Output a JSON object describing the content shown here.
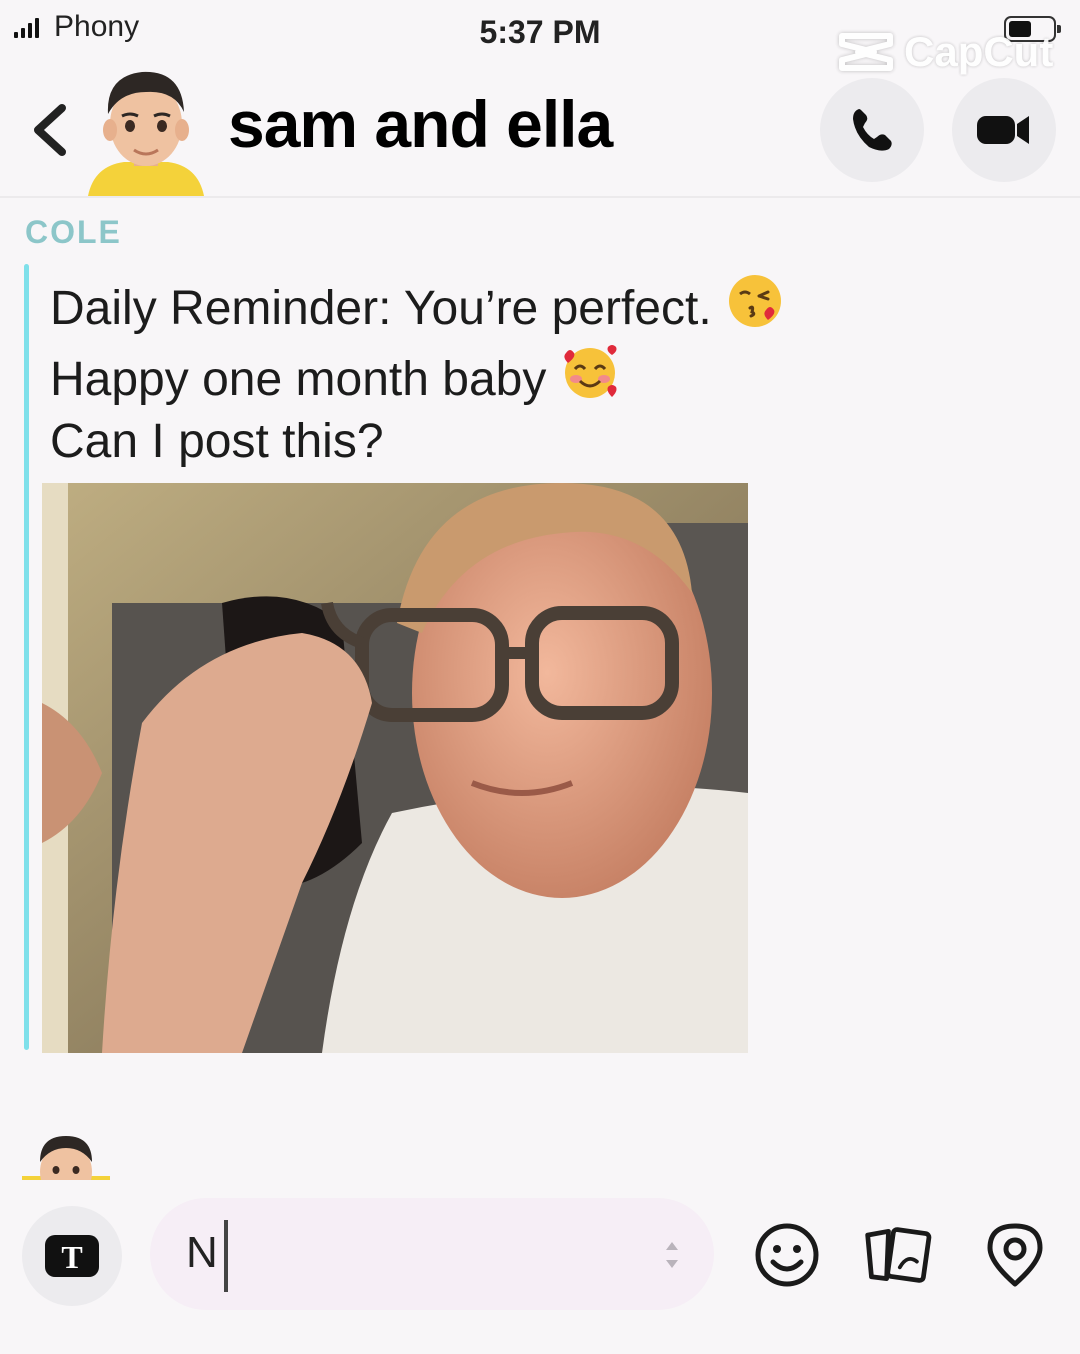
{
  "status_bar": {
    "carrier": "Phony",
    "time": "5:37 PM"
  },
  "watermark": {
    "text": "CapCut"
  },
  "header": {
    "title": "sam and ella",
    "back_icon": "chevron-left-icon",
    "call_icon": "phone-icon",
    "video_icon": "video-camera-icon"
  },
  "message": {
    "sender": "COLE",
    "accent_color": "#7fe0ea",
    "lines": [
      {
        "text": "Daily Reminder: You’re perfect.",
        "emoji": "face-blowing-kiss"
      },
      {
        "text": "Happy one month baby",
        "emoji": "smiling-face-with-hearts"
      },
      {
        "text": "Can I post this?"
      }
    ],
    "attachment": "photo"
  },
  "composer": {
    "value": "N",
    "text_tool_icon": "text-T-icon",
    "tools": [
      "smiley-icon",
      "cards-icon",
      "map-pin-icon"
    ]
  }
}
